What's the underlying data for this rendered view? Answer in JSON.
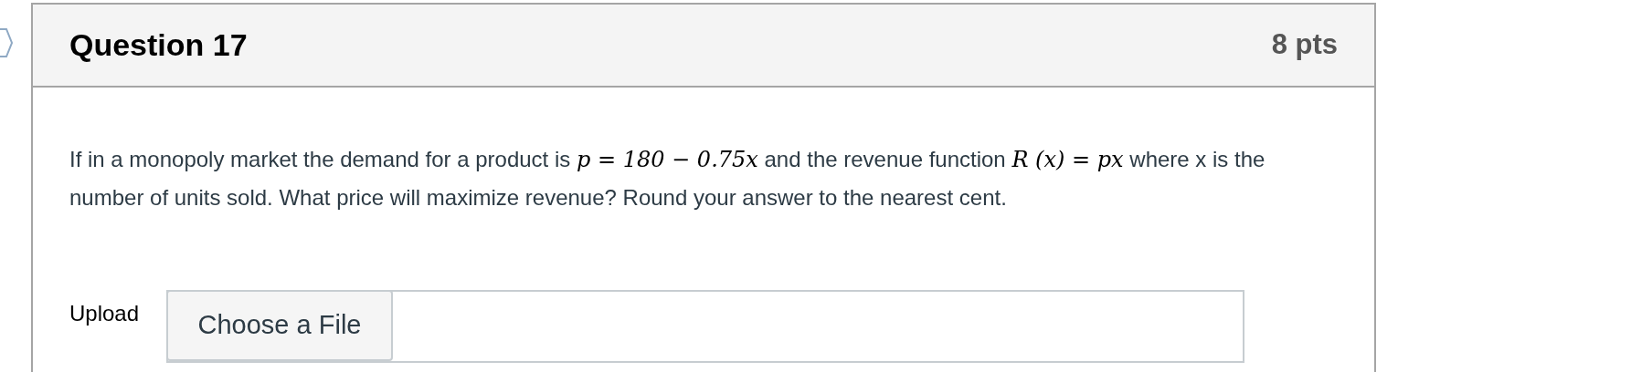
{
  "question": {
    "title": "Question 17",
    "points": "8 pts"
  },
  "body": "If in a monopoly market the demand for a product is **p = 180 − 0.75x** and the revenue function **R (x) = px** where x is the number of units sold. What price will maximize revenue? Round your answer to the nearest cent.",
  "upload": {
    "label": "Upload",
    "button": "Choose a File"
  }
}
